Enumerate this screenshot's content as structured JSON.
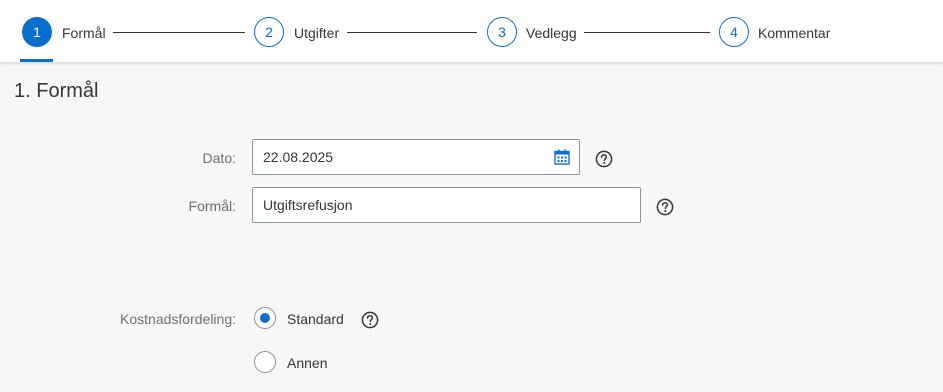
{
  "wizard": {
    "steps": [
      {
        "number": "1",
        "label": "Formål",
        "active": true
      },
      {
        "number": "2",
        "label": "Utgifter",
        "active": false
      },
      {
        "number": "3",
        "label": "Vedlegg",
        "active": false
      },
      {
        "number": "4",
        "label": "Kommentar",
        "active": false
      }
    ]
  },
  "section": {
    "title": "1. Formål"
  },
  "form": {
    "date": {
      "label": "Dato:",
      "value": "22.08.2025"
    },
    "purpose": {
      "label": "Formål:",
      "value": "Utgiftsrefusjon"
    },
    "cost_distribution": {
      "label": "Kostnadsfordeling:",
      "options": [
        {
          "label": "Standard",
          "selected": true
        },
        {
          "label": "Annen",
          "selected": false
        }
      ]
    }
  },
  "colors": {
    "accent": "#0a6ed1",
    "text": "#32363a",
    "label": "#6a6d70",
    "background": "#f7f7f7"
  },
  "icons": {
    "date_picker": "calendar-icon",
    "help": "help-circle-icon"
  }
}
